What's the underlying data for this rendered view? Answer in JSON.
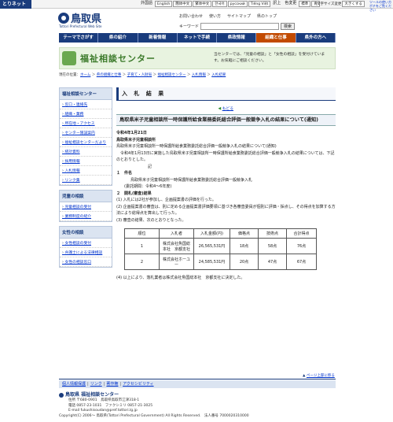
{
  "topbar": {
    "brand": "とりネット",
    "lang_label": "外国語",
    "languages": [
      "English",
      "簡体中文",
      "繁体中文",
      "한국어",
      "русский",
      "Tiếng Việt"
    ],
    "translate_note": "訳上",
    "aux": [
      "色変更",
      "標準",
      "青"
    ],
    "textsize_label": "文字サイズ変更",
    "textsize_btn": "大きくする",
    "tools_link": "ツールの使い方ポチをご覧ください"
  },
  "header": {
    "logo": "鳥取県",
    "logo_sub": "Tottori Prefectural Web Site",
    "links": [
      "お問い合わせ",
      "使い方",
      "サイトマップ",
      "県のトップ"
    ],
    "keyword_label": "キーワード",
    "search_button": "検索"
  },
  "gnav": [
    "テーマでさがす",
    "県の紹介",
    "新着情報",
    "ネットで手続",
    "県政情報",
    "組織と仕事",
    "県外の方へ"
  ],
  "banner": {
    "title": "福祉相談センター",
    "text": "当センターでは、「児童の相談」と「女性の相談」を受付けています。お気軽にご相談ください。"
  },
  "breadcrumb": {
    "label": "現在の位置：",
    "items": [
      "ホーム",
      "県の組織と仕事",
      "子育て・人財局",
      "福祉相談センター",
      "入札情報",
      "入札結果"
    ]
  },
  "sidebar": [
    {
      "heading": "福祉相談センター",
      "items": [
        "窓口・連絡先",
        "組織・業務",
        "所在地・アクセス",
        "センター施設案内",
        "福祉相談センターだより",
        "統計資料",
        "採用情報",
        "入札情報",
        "リンク集"
      ]
    },
    {
      "heading": "児童の相談",
      "items": [
        "児童相談の受付",
        "業務制度の紹介"
      ]
    },
    {
      "heading": "女性の相談",
      "items": [
        "女性相談の受付",
        "弁護士による法律相談",
        "女性の相談窓口"
      ]
    }
  ],
  "main": {
    "title": "入 札 結 果",
    "back": "もどる",
    "heading": "鳥取県米子児童相談所一時保護所給食業務委託総合評価一般競争入札の結果について(通知)",
    "date": "令和4年1月21日",
    "org": "鳥取県米子児童相談所",
    "subject": "鳥取県米子児童相談所一時保護所給食業務委託総合評価一般競争入札の結果について(通知)",
    "intro": "令和4年1月13日に実施した鳥取県米子児童相談所一時保護所給食業務委託総合評価一般競争入札の結果については、下記のとおりとした。",
    "ki": "記",
    "item1_title": "１　件名",
    "item1_body": "鳥取県米子児童相談所一時保護所給食業務委託総合評価一般競争入札",
    "item1_period": "(委託期間：令和4～6年度)",
    "item2_title": "２　開札(審査)結果",
    "item2_1": "(1) 入札には2社が参加し、企画提案書の評価を行った。",
    "item2_2": "(2) 企画提案書の審査は、別に定める企画提案書評価要領に基づき各審査委員が個別に評価・採点し、その得点を加算する方法により総得点を算出して行った。",
    "item2_3": "(3) 審査の結果、次のとおりとなった。",
    "table": {
      "headers": [
        "順位",
        "入札者",
        "入札金額(円)",
        "価格点",
        "技術点",
        "合計得点"
      ],
      "rows": [
        [
          "1",
          "株式会社魚国総本社　京都支社",
          "26,565,531円",
          "18点",
          "58点",
          "76点"
        ],
        [
          "2",
          "株式会社ホーユー",
          "24,585,531円",
          "20点",
          "47点",
          "67点"
        ]
      ]
    },
    "conclusion": "(4) 以上により、落札業者は株式会社魚国総本社　京都支社に決定した。"
  },
  "footer": {
    "pagetop": "ページ上部に移る",
    "links": [
      "個人情報保護",
      "リンク",
      "著作権",
      "アクセシビリティ"
    ],
    "org_name": "鳥取県 福祉相談センター",
    "address": "住所 〒680-0901　鳥取県鳥取市江津318-1",
    "phone": "電話 0857-23-1031　ファクシミリ 0857-21-3025",
    "email": "E-mail fukushisoudan@pref.tottori.lg.jp",
    "copyright": "Copyright(C) 2006～ 鳥取県(Tottori Prefectural Government) All Rights Reserved.　法人番号 7000020310000"
  }
}
